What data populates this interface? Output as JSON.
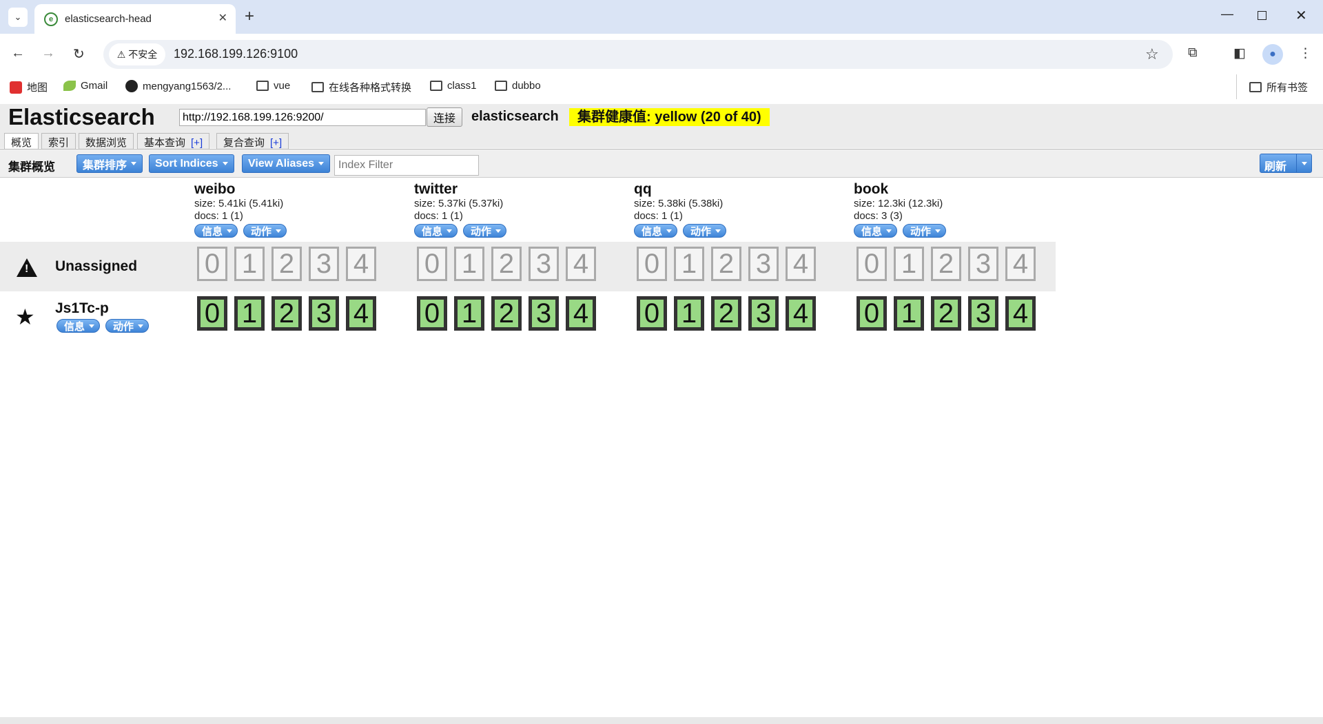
{
  "browser": {
    "tab_title": "elasticsearch-head",
    "security_label": "不安全",
    "url": "192.168.199.126:9100",
    "bookmarks": [
      "地图",
      "Gmail",
      "mengyang1563/2...",
      "vue",
      "在线各种格式转换",
      "class1",
      "dubbo"
    ],
    "all_bookmarks": "所有书签"
  },
  "app": {
    "logo": "Elasticsearch",
    "connect_url": "http://192.168.199.126:9200/",
    "connect_label": "连接",
    "cluster_name": "elasticsearch",
    "health": "集群健康值: yellow (20 of 40)",
    "health_color": "#ffff00",
    "info_label": "信息",
    "tabs": [
      {
        "label": "概览",
        "plus": ""
      },
      {
        "label": "索引",
        "plus": ""
      },
      {
        "label": "数据浏览",
        "plus": ""
      },
      {
        "label": "基本查询",
        "plus": "[+]"
      },
      {
        "label": "复合查询",
        "plus": "[+]"
      }
    ]
  },
  "overview": {
    "title": "集群概览",
    "sort_cluster_label": "集群排序",
    "sort_indices_label": "Sort Indices",
    "view_aliases_label": "View Aliases",
    "filter_placeholder": "Index Filter",
    "refresh_label": "刷新",
    "info_label": "信息",
    "action_label": "动作",
    "indices": [
      {
        "name": "weibo",
        "size": "size: 5.41ki (5.41ki)",
        "docs": "docs: 1 (1)"
      },
      {
        "name": "twitter",
        "size": "size: 5.37ki (5.37ki)",
        "docs": "docs: 1 (1)"
      },
      {
        "name": "qq",
        "size": "size: 5.38ki (5.38ki)",
        "docs": "docs: 1 (1)"
      },
      {
        "name": "book",
        "size": "size: 12.3ki (12.3ki)",
        "docs": "docs: 3 (3)"
      }
    ],
    "shards": [
      "0",
      "1",
      "2",
      "3",
      "4"
    ],
    "unassigned_label": "Unassigned",
    "node_name": "Js1Tc-p",
    "shard_color_assigned": "#99d985"
  }
}
